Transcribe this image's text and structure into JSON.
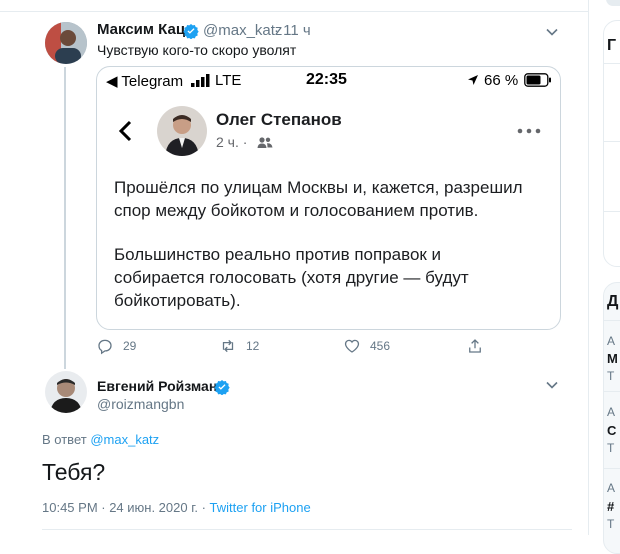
{
  "tweet": {
    "author_name": "Максим Кац",
    "handle": "@max_katz",
    "time_ago": "· 11 ч",
    "text": "Чувствую кого-то скоро уволят",
    "reply_count": "29",
    "retweet_count": "12",
    "like_count": "456"
  },
  "embedded": {
    "status_carrier": "◀ Telegram",
    "status_network": "LTE",
    "status_time": "22:35",
    "status_battery": "66 %",
    "post_author": "Олег Степанов",
    "post_time": "2 ч. ·",
    "paragraph1_line1": "Прошёлся по улицам Москвы и, кажется, разрешил",
    "paragraph1_line2": "спор между бойкотом и голосованием против.",
    "paragraph2_line1": "Большинство реально против поправок и",
    "paragraph2_line2": "собирается голосовать (хотя другие — будут",
    "paragraph2_line3": "бойкотировать)."
  },
  "reply": {
    "author_name": "Евгений Ройзман",
    "handle": "@roizmangbn",
    "in_reply_prefix": "В ответ",
    "in_reply_handle": "@max_katz",
    "text": "Тебя?",
    "timestamp": "10:45 PM · 24 июн. 2020 г. · ",
    "source": "Twitter for iPhone"
  },
  "sidebar_fragments": {
    "item1_letter": "Г",
    "item2_letter": "Д",
    "row1_sub": "А",
    "row1_main": "М",
    "row1_tail": "Т",
    "row2_sub": "А",
    "row2_main": "С",
    "row2_tail": "Т",
    "row3_sub": "А",
    "row3_main": "#",
    "row3_tail": "Т"
  },
  "colors": {
    "accent": "#1da1f2",
    "verified": "#1da1f2",
    "muted": "#657786",
    "border": "#e6ecf0"
  },
  "icons": [
    "chevron-down-icon",
    "verified-badge-icon",
    "reply-icon",
    "retweet-icon",
    "like-icon",
    "share-icon",
    "back-chevron-icon",
    "more-dots-icon",
    "friends-icon",
    "location-arrow-icon",
    "battery-icon",
    "signal-bars-icon"
  ]
}
